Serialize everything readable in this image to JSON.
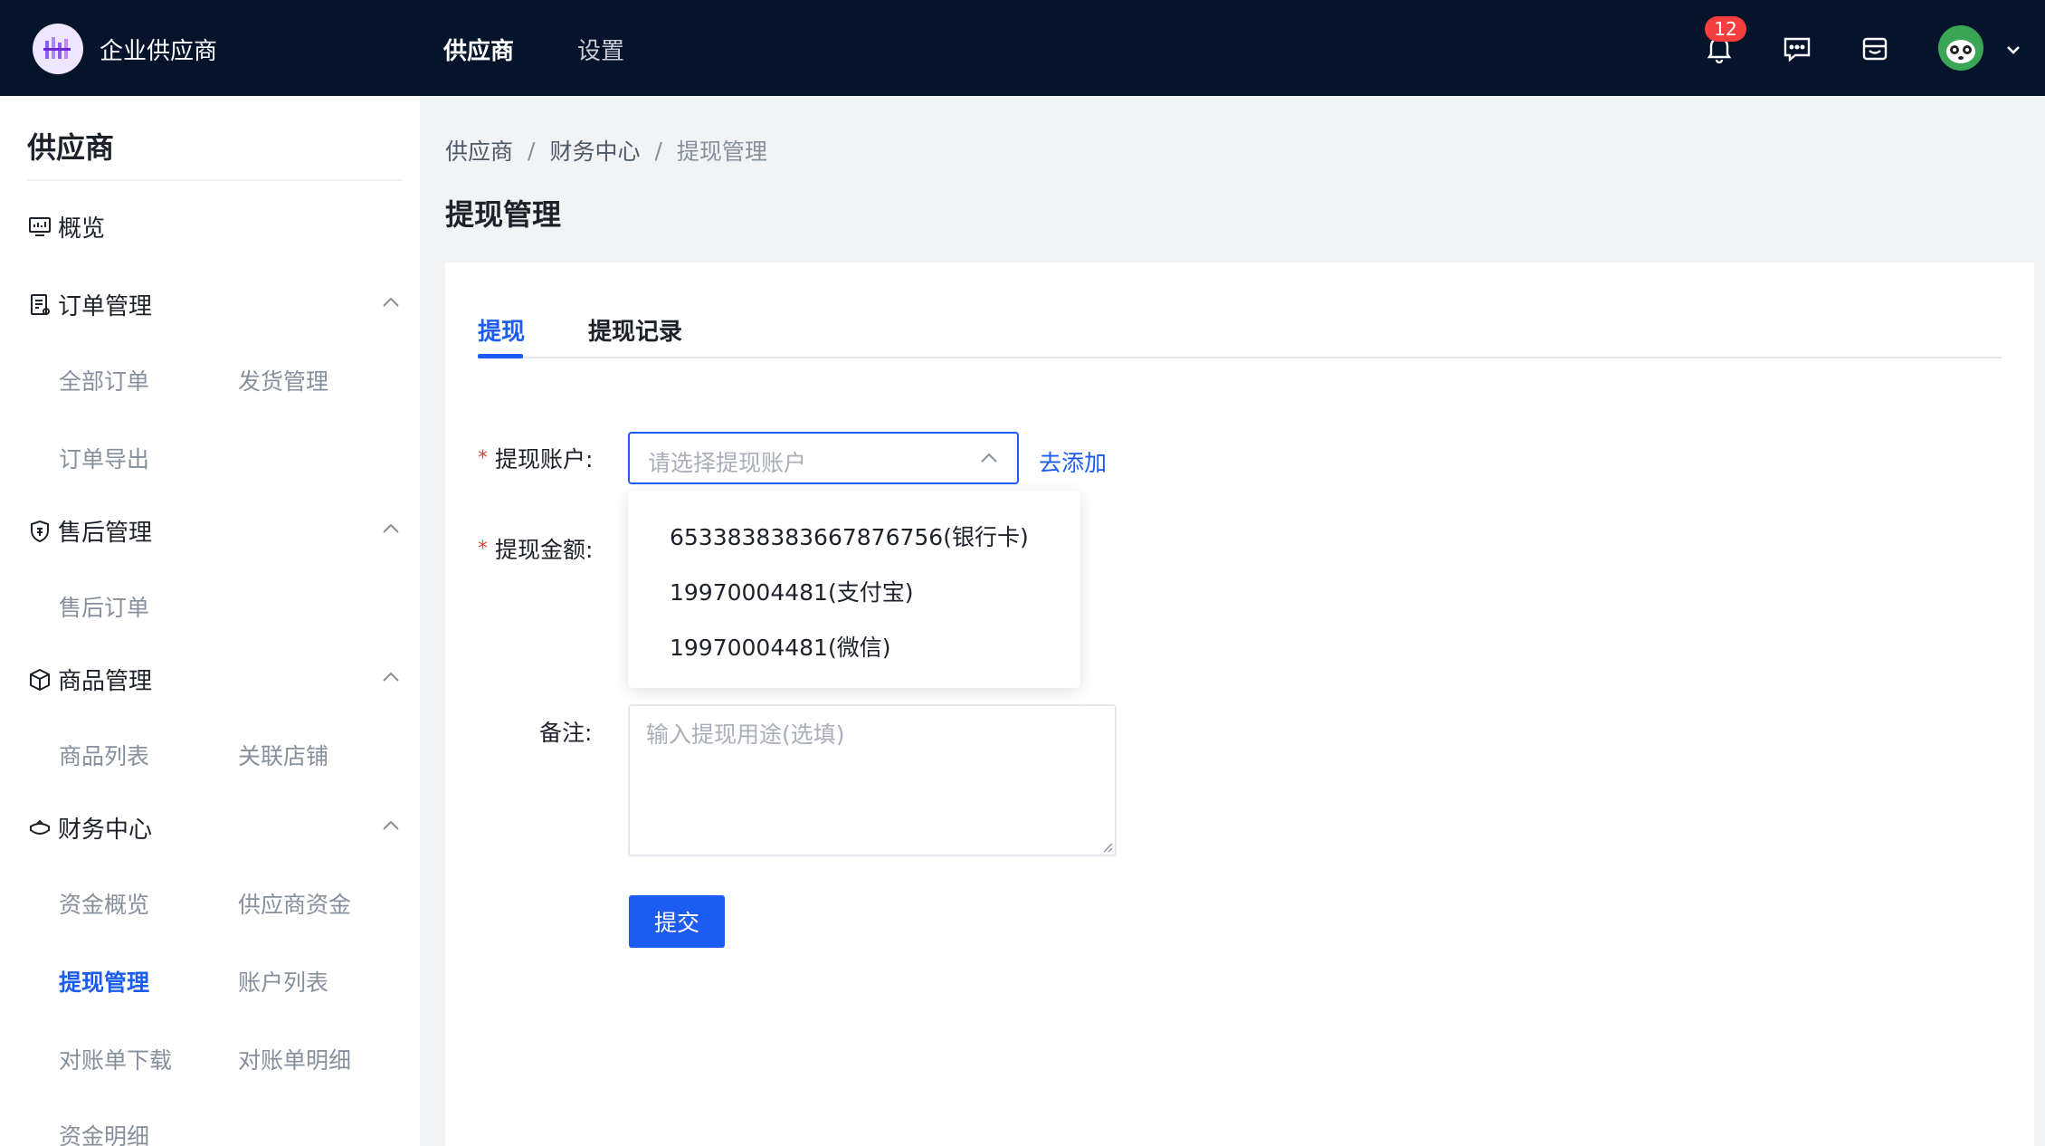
{
  "header": {
    "brand": "企业供应商",
    "nav": [
      {
        "label": "供应商",
        "active": true
      },
      {
        "label": "设置",
        "active": false
      }
    ],
    "notification_count": "12"
  },
  "sidebar": {
    "title": "供应商",
    "overview": "概览",
    "groups": [
      {
        "label": "订单管理",
        "icon": "order-icon",
        "items": [
          "全部订单",
          "发货管理",
          "订单导出"
        ]
      },
      {
        "label": "售后管理",
        "icon": "after-sales-icon",
        "items": [
          "售后订单"
        ]
      },
      {
        "label": "商品管理",
        "icon": "product-box-icon",
        "items": [
          "商品列表",
          "关联店铺"
        ]
      },
      {
        "label": "财务中心",
        "icon": "finance-icon",
        "items": [
          "资金概览",
          "供应商资金",
          "提现管理",
          "账户列表",
          "对账单下载",
          "对账单明细",
          "资金明细"
        ]
      }
    ],
    "active_item": "提现管理"
  },
  "breadcrumb": [
    "供应商",
    "财务中心",
    "提现管理"
  ],
  "page_title": "提现管理",
  "tabs": [
    {
      "label": "提现",
      "active": true
    },
    {
      "label": "提现记录",
      "active": false
    }
  ],
  "form": {
    "account_label": "提现账户:",
    "account_placeholder": "请选择提现账户",
    "add_link": "去添加",
    "amount_label": "提现金额:",
    "remark_label": "备注:",
    "remark_placeholder": "输入提现用途(选填)",
    "submit_label": "提交",
    "account_options": [
      "6533838383667876756(银行卡)",
      "19970004481(支付宝)",
      "19970004481(微信)"
    ]
  },
  "colors": {
    "header_bg": "#05132b",
    "primary": "#1d5cf0",
    "badge": "#f53f3f",
    "page_bg": "#f2f3f5"
  }
}
